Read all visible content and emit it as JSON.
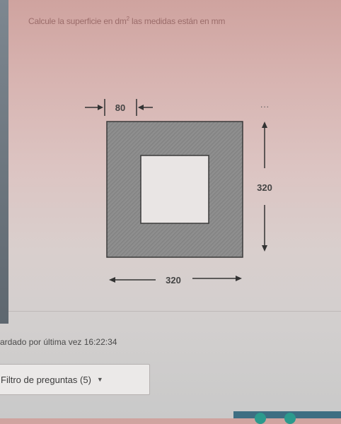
{
  "question": {
    "text_before": "Calcule la superficie en dm",
    "superscript": "2",
    "text_after": " las medidas están en mm"
  },
  "figure": {
    "wall_dimension": "80",
    "height_dimension": "320",
    "width_dimension": "320",
    "more_indicator": "..."
  },
  "status": {
    "saved_text": "ardado por última vez 16:22:34"
  },
  "filter": {
    "label": "Filtro de preguntas (5)",
    "caret": "▼"
  },
  "colors": {
    "question_text": "#9b6c6a",
    "shape_fill": "#8b8b8b",
    "footer_bar": "#3d6e82"
  }
}
